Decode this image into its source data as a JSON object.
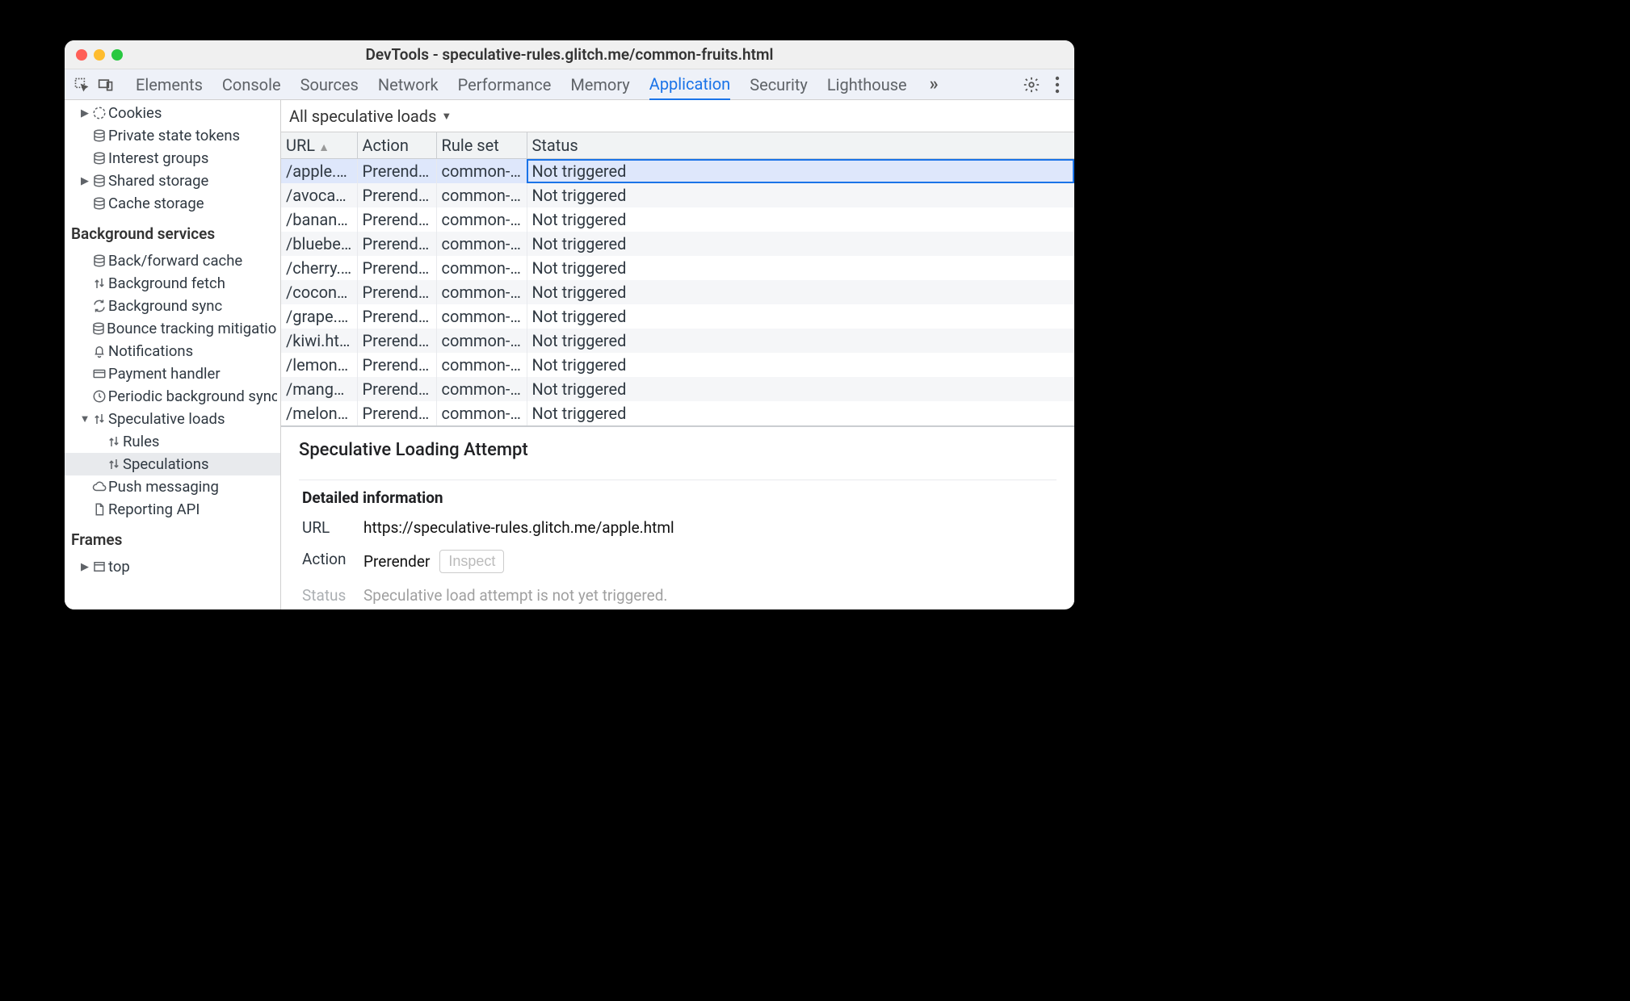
{
  "window": {
    "title": "DevTools - speculative-rules.glitch.me/common-fruits.html"
  },
  "tabs": {
    "items": [
      "Elements",
      "Console",
      "Sources",
      "Network",
      "Performance",
      "Memory",
      "Application",
      "Security",
      "Lighthouse"
    ],
    "active": "Application"
  },
  "sidebar": {
    "storage": {
      "items": [
        {
          "label": "Cookies",
          "icon": "cookie",
          "caret": true
        },
        {
          "label": "Private state tokens",
          "icon": "db"
        },
        {
          "label": "Interest groups",
          "icon": "db"
        },
        {
          "label": "Shared storage",
          "icon": "db",
          "caret": true
        },
        {
          "label": "Cache storage",
          "icon": "db"
        }
      ]
    },
    "bg_header": "Background services",
    "bg": {
      "items": [
        {
          "label": "Back/forward cache",
          "icon": "db"
        },
        {
          "label": "Background fetch",
          "icon": "updown"
        },
        {
          "label": "Background sync",
          "icon": "sync"
        },
        {
          "label": "Bounce tracking mitigations",
          "icon": "db"
        },
        {
          "label": "Notifications",
          "icon": "bell"
        },
        {
          "label": "Payment handler",
          "icon": "card"
        },
        {
          "label": "Periodic background sync",
          "icon": "clock"
        },
        {
          "label": "Speculative loads",
          "icon": "updown",
          "caret": true,
          "open": true,
          "children": [
            {
              "label": "Rules",
              "icon": "updown"
            },
            {
              "label": "Speculations",
              "icon": "updown",
              "selected": true
            }
          ]
        },
        {
          "label": "Push messaging",
          "icon": "cloud"
        },
        {
          "label": "Reporting API",
          "icon": "page"
        }
      ]
    },
    "frames_header": "Frames",
    "frames": {
      "items": [
        {
          "label": "top",
          "icon": "frame",
          "caret": true
        }
      ]
    }
  },
  "filter": {
    "label": "All speculative loads"
  },
  "columns": {
    "url": "URL",
    "action": "Action",
    "rule": "Rule set",
    "status": "Status"
  },
  "rows": [
    {
      "url": "/apple.html",
      "action": "Prerender",
      "rule": "common-fr…",
      "status": "Not triggered",
      "selected": true
    },
    {
      "url": "/avocad…",
      "action": "Prerender",
      "rule": "common-fr…",
      "status": "Not triggered"
    },
    {
      "url": "/banana.…",
      "action": "Prerender",
      "rule": "common-fr…",
      "status": "Not triggered"
    },
    {
      "url": "/blueberr…",
      "action": "Prerender",
      "rule": "common-fr…",
      "status": "Not triggered"
    },
    {
      "url": "/cherry.h…",
      "action": "Prerender",
      "rule": "common-fr…",
      "status": "Not triggered"
    },
    {
      "url": "/coconut…",
      "action": "Prerender",
      "rule": "common-fr…",
      "status": "Not triggered"
    },
    {
      "url": "/grape.html",
      "action": "Prerender",
      "rule": "common-fr…",
      "status": "Not triggered"
    },
    {
      "url": "/kiwi.html",
      "action": "Prerender",
      "rule": "common-fr…",
      "status": "Not triggered"
    },
    {
      "url": "/lemon.h…",
      "action": "Prerender",
      "rule": "common-fr…",
      "status": "Not triggered"
    },
    {
      "url": "/mango.…",
      "action": "Prerender",
      "rule": "common-fr…",
      "status": "Not triggered"
    },
    {
      "url": "/melon.h…",
      "action": "Prerender",
      "rule": "common-fr…",
      "status": "Not triggered"
    }
  ],
  "detail": {
    "heading": "Speculative Loading Attempt",
    "subheading": "Detailed information",
    "url_label": "URL",
    "url_value": "https://speculative-rules.glitch.me/apple.html",
    "action_label": "Action",
    "action_value": "Prerender",
    "inspect_label": "Inspect",
    "status_label": "Status",
    "status_value": "Speculative load attempt is not yet triggered."
  }
}
